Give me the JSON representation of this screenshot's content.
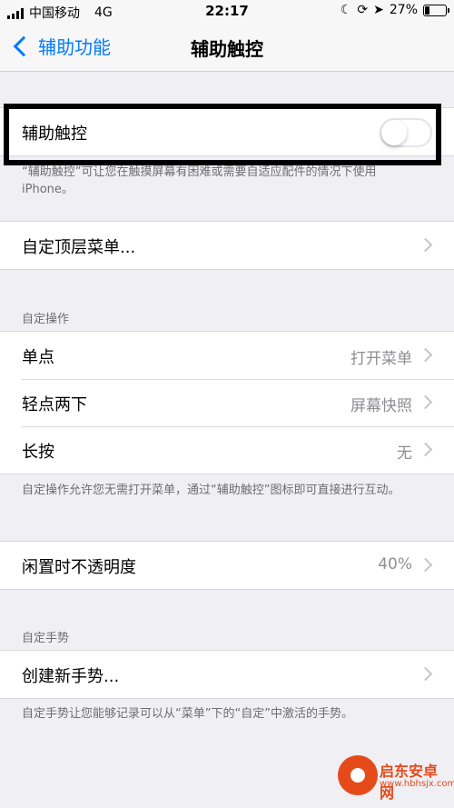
{
  "status_bar": {
    "carrier": "中国移动",
    "network": "4G",
    "time": "22:17",
    "battery": "27%",
    "battery_level": 0.27,
    "icons": [
      "moon-icon",
      "lock-rotation-icon",
      "location-icon",
      "battery-icon"
    ]
  },
  "nav": {
    "back_label": "辅助功能",
    "title": "辅助触控"
  },
  "main_toggle": {
    "label": "辅助触控",
    "state": "off",
    "description": "“辅助触控”可让您在触摸屏幕有困难或需要自适应配件的情况下使用 iPhone。"
  },
  "top_menu": {
    "label": "自定顶层菜单..."
  },
  "custom_actions": {
    "header": "自定操作",
    "rows": [
      {
        "label": "单点",
        "value": "打开菜单"
      },
      {
        "label": "轻点两下",
        "value": "屏幕快照"
      },
      {
        "label": "长按",
        "value": "无"
      }
    ],
    "footer": "自定操作允许您无需打开菜单，通过“辅助触控”图标即可直接进行互动。"
  },
  "idle_opacity": {
    "label": "闲置时不透明度",
    "value": "40%"
  },
  "custom_gestures": {
    "header": "自定手势",
    "create_label": "创建新手势...",
    "footer": "自定手势让您能够记录可以从“菜单”下的“自定”中激活的手势。"
  },
  "watermark": {
    "name": "启东安卓网",
    "url": "www.hbhsjx.com"
  },
  "colors": {
    "accent": "#007aff",
    "background": "#efeff4",
    "secondary_text": "#8e8e93"
  }
}
